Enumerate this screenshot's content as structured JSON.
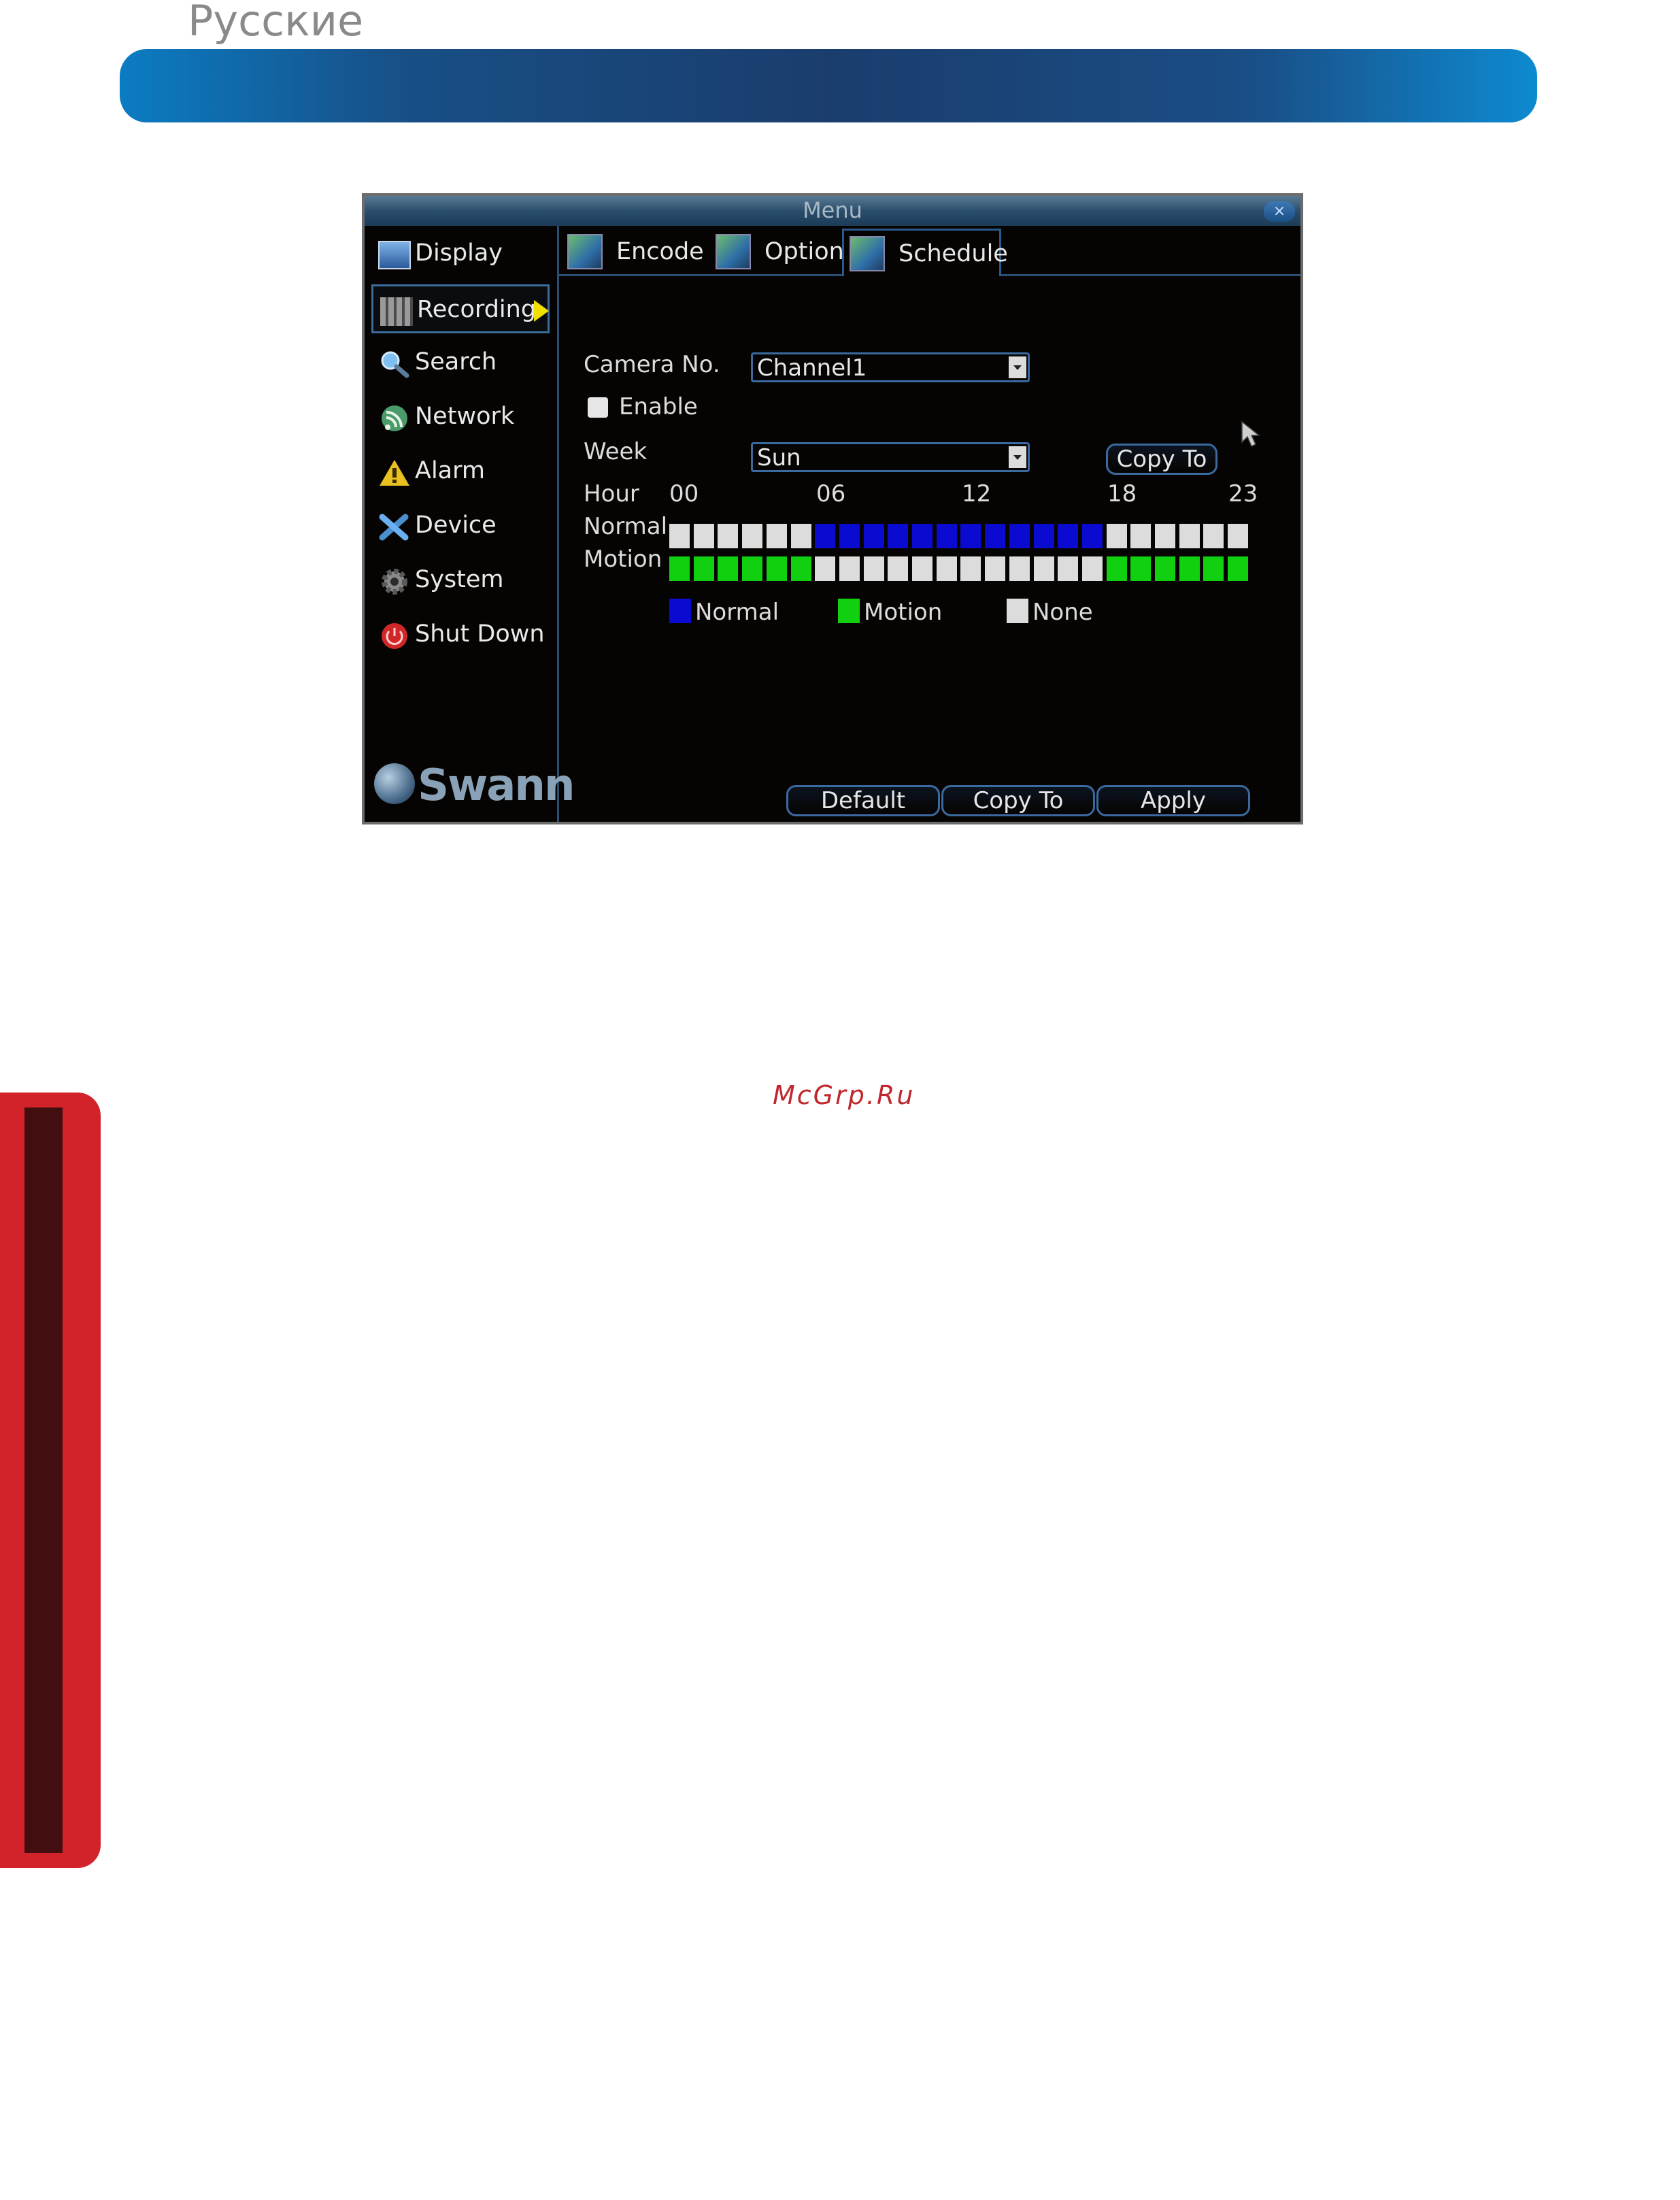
{
  "page": {
    "heading": "Русские",
    "watermark": "McGrp.Ru"
  },
  "window": {
    "title": "Menu",
    "close_label": "×"
  },
  "sidebar": {
    "items": [
      {
        "label": "Display",
        "icon": "display-icon"
      },
      {
        "label": "Recording",
        "icon": "recording-icon",
        "active": true
      },
      {
        "label": "Search",
        "icon": "search-icon"
      },
      {
        "label": "Network",
        "icon": "network-icon"
      },
      {
        "label": "Alarm",
        "icon": "alarm-icon"
      },
      {
        "label": "Device",
        "icon": "device-icon"
      },
      {
        "label": "System",
        "icon": "system-icon"
      },
      {
        "label": "Shut Down",
        "icon": "power-icon"
      }
    ],
    "brand": "Swann"
  },
  "tabs": [
    {
      "label": "Encode",
      "active": false
    },
    {
      "label": "Option",
      "active": false
    },
    {
      "label": "Schedule",
      "active": true
    }
  ],
  "form": {
    "camera_label": "Camera No.",
    "camera_value": "Channel1",
    "enable_label": "Enable",
    "enable_checked": false,
    "week_label": "Week",
    "week_value": "Sun",
    "copy_to_label": "Copy To"
  },
  "schedule": {
    "hour_label": "Hour",
    "hour_ticks": [
      "00",
      "06",
      "12",
      "18",
      "23"
    ],
    "normal_label": "Normal",
    "motion_label": "Motion",
    "normal_hours": [
      0,
      0,
      0,
      0,
      0,
      0,
      1,
      1,
      1,
      1,
      1,
      1,
      1,
      1,
      1,
      1,
      1,
      1,
      0,
      0,
      0,
      0,
      0,
      0
    ],
    "motion_hours": [
      1,
      1,
      1,
      1,
      1,
      1,
      0,
      0,
      0,
      0,
      0,
      0,
      0,
      0,
      0,
      0,
      0,
      0,
      1,
      1,
      1,
      1,
      1,
      1
    ],
    "colors": {
      "normal": "#0a0ad0",
      "motion": "#10d010",
      "none": "#dcdcdc"
    }
  },
  "legend": [
    {
      "label": "Normal",
      "color": "#0a0ad0"
    },
    {
      "label": "Motion",
      "color": "#10d010"
    },
    {
      "label": "None",
      "color": "#dcdcdc"
    }
  ],
  "footer_buttons": {
    "default": "Default",
    "copy_to": "Copy To",
    "apply": "Apply"
  }
}
